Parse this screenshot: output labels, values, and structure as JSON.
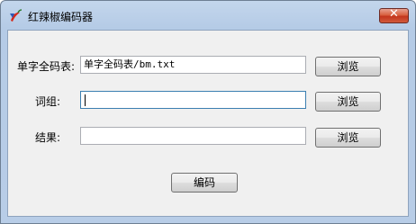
{
  "window": {
    "title": "红辣椒编码器",
    "close_glyph": "✕"
  },
  "form": {
    "table_label": "单字全码表:",
    "table_value": "单字全码表/bm.txt",
    "phrase_label": "词组:",
    "phrase_value": "",
    "result_label": "结果:",
    "result_value": ""
  },
  "buttons": {
    "browse_1": "浏览",
    "browse_2": "浏览",
    "browse_3": "浏览",
    "encode": "编码"
  },
  "icons": {
    "app": "chili-pepper-icon",
    "close": "close-icon"
  },
  "colors": {
    "close_button": "#c4361d",
    "title_bar": "#b5cbe6"
  }
}
